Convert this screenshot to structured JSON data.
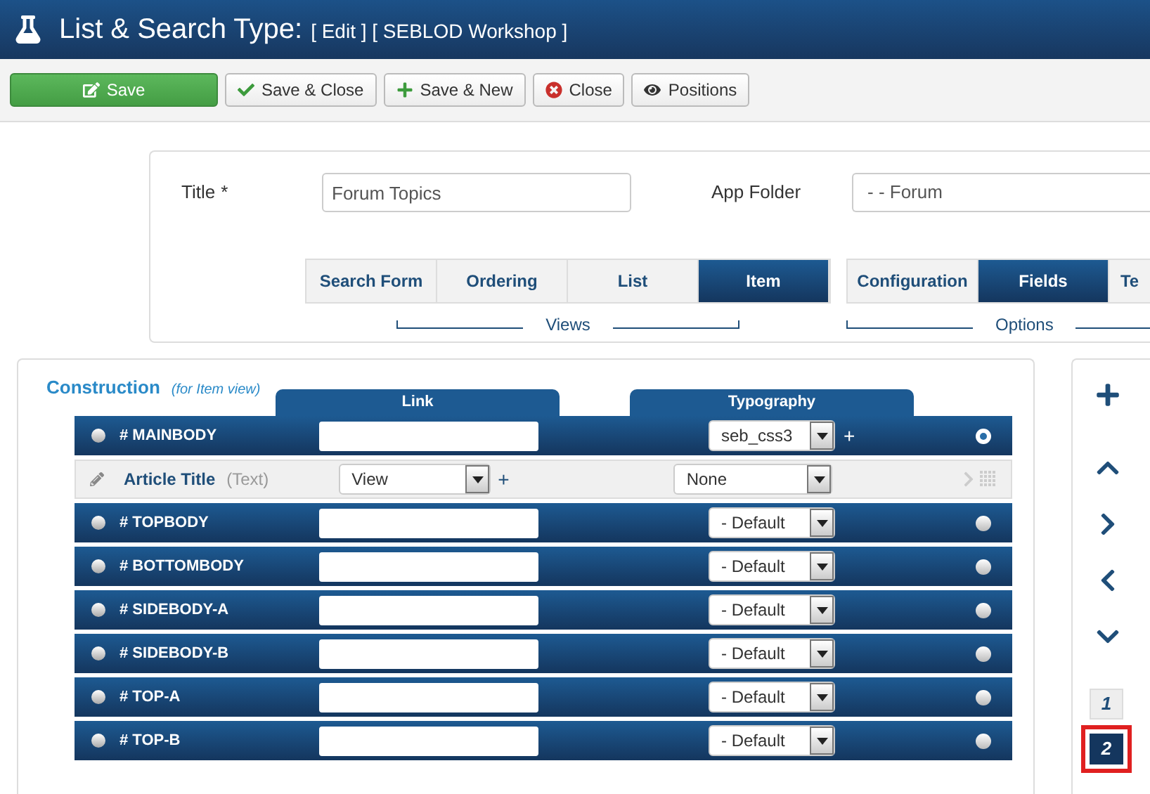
{
  "header": {
    "title": "List & Search Type:",
    "subtitle": "[ Edit ] [ SEBLOD Workshop ]"
  },
  "toolbar": [
    {
      "label": "Save",
      "kind": "primary"
    },
    {
      "label": "Save & Close",
      "kind": "check"
    },
    {
      "label": "Save & New",
      "kind": "plus"
    },
    {
      "label": "Close",
      "kind": "close"
    },
    {
      "label": "Positions",
      "kind": "eye"
    }
  ],
  "form": {
    "title_label": "Title",
    "required_mark": "*",
    "title_value": "Forum Topics",
    "folder_label": "App Folder",
    "folder_value": "- - Forum"
  },
  "views": {
    "label": "Views",
    "tabs": [
      {
        "label": "Search Form",
        "selected": false
      },
      {
        "label": "Ordering",
        "selected": false
      },
      {
        "label": "List",
        "selected": false
      },
      {
        "label": "Item",
        "selected": true
      }
    ]
  },
  "options": {
    "label": "Options",
    "tabs": [
      {
        "label": "Configuration",
        "selected": false
      },
      {
        "label": "Fields",
        "selected": true
      },
      {
        "label": "Te",
        "selected": false
      }
    ]
  },
  "construction": {
    "title": "Construction",
    "subtitle": "(for Item view)",
    "columns": [
      "Link",
      "Typography"
    ],
    "rows": [
      {
        "kind": "position",
        "name": "# MAINBODY",
        "typography": "seb_css3",
        "add": "+",
        "selected": true
      },
      {
        "kind": "field",
        "name": "Article Title",
        "type": "(Text)",
        "link": "View",
        "add": "+",
        "typography": "None"
      },
      {
        "kind": "position",
        "name": "# TOPBODY",
        "typography": "- Default",
        "selected": false
      },
      {
        "kind": "position",
        "name": "# BOTTOMBODY",
        "typography": "- Default",
        "selected": false
      },
      {
        "kind": "position",
        "name": "# SIDEBODY-A",
        "typography": "- Default",
        "selected": false
      },
      {
        "kind": "position",
        "name": "# SIDEBODY-B",
        "typography": "- Default",
        "selected": false
      },
      {
        "kind": "position",
        "name": "# TOP-A",
        "typography": "- Default",
        "selected": false
      },
      {
        "kind": "position",
        "name": "# TOP-B",
        "typography": "- Default",
        "selected": false
      }
    ]
  },
  "side_panel": {
    "pages": [
      {
        "label": "1",
        "selected": false
      },
      {
        "label": "2",
        "selected": true
      }
    ]
  }
}
